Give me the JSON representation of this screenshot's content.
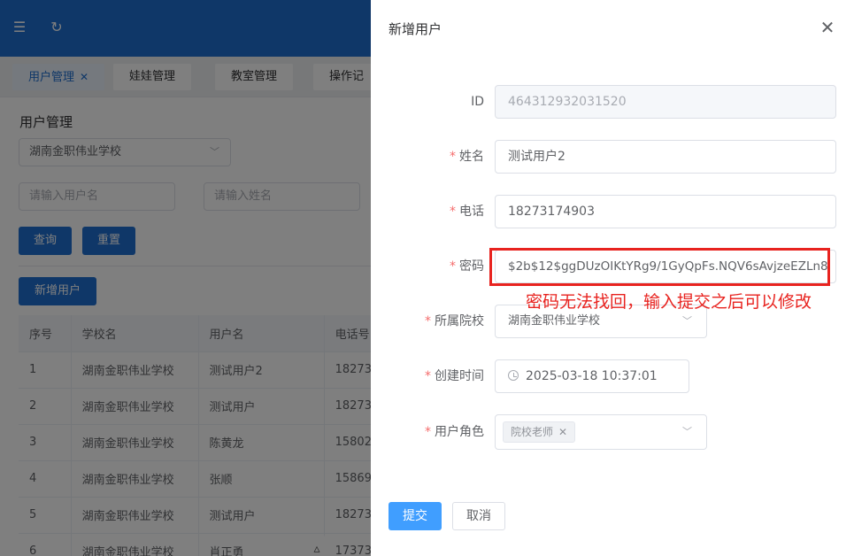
{
  "background": {
    "topbar": {
      "menu_icon": "menu-fold-icon",
      "refresh_icon": "refresh-icon",
      "color": "#1f6fd0"
    },
    "tabs": [
      {
        "label": "用户管理",
        "active": true,
        "closable": true
      },
      {
        "label": "娃娃管理"
      },
      {
        "label": "教室管理"
      },
      {
        "label": "操作记"
      }
    ],
    "page_title": "用户管理",
    "school_filter": "湖南金职伟业学校",
    "username_placeholder": "请输入用户名",
    "name_placeholder": "请输入姓名",
    "query_label": "查询",
    "reset_label": "重置",
    "add_user_label": "新增用户",
    "table": {
      "headers": [
        "序号",
        "学校名",
        "用户名",
        "电话号"
      ],
      "rows": [
        [
          "1",
          "湖南金职伟业学校",
          "测试用户2",
          "18273"
        ],
        [
          "2",
          "湖南金职伟业学校",
          "测试用户",
          "18273"
        ],
        [
          "3",
          "湖南金职伟业学校",
          "陈黄龙",
          "15802"
        ],
        [
          "4",
          "湖南金职伟业学校",
          "张顺",
          "15869"
        ],
        [
          "5",
          "湖南金职伟业学校",
          "测试用户",
          "18273"
        ],
        [
          "6",
          "湖南金职伟业学校",
          "肖正勇",
          "17373"
        ]
      ]
    }
  },
  "drawer": {
    "title": "新增用户",
    "close_icon": "close-icon",
    "fields": {
      "id": {
        "label": "ID",
        "value": "464312932031520"
      },
      "name": {
        "label": "姓名",
        "value": "测试用户2"
      },
      "phone": {
        "label": "电话",
        "value": "18273174903"
      },
      "password": {
        "label": "密码",
        "value": "$2b$12$ggDUzOIKtYRg9/1GyQpFs.NQV6sAvjzeEZLn8"
      },
      "school": {
        "label": "所属院校",
        "value": "湖南金职伟业学校"
      },
      "created": {
        "label": "创建时间",
        "value": "2025-03-18 10:37:01"
      },
      "role": {
        "label": "用户角色",
        "tag": "院校老师"
      }
    },
    "annotation": "密码无法找回，输入提交之后可以修改",
    "submit_label": "提交",
    "cancel_label": "取消",
    "accent": "#409eff",
    "annotation_color": "#e8231f"
  }
}
